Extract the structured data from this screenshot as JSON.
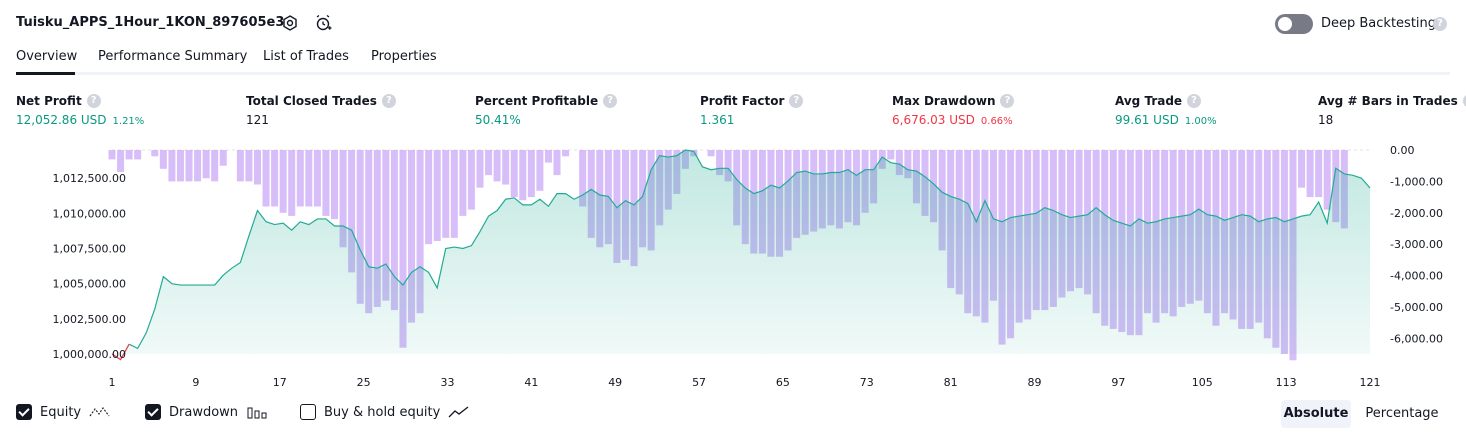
{
  "header": {
    "strategy_name": "Tuisku_APPS_1Hour_1KON_897605e3",
    "settings_icon": "settings-icon",
    "add_alert_icon": "alarm-plus-icon",
    "deep_backtesting_label": "Deep Backtesting",
    "deep_backtesting_enabled": false,
    "help_glyph": "?"
  },
  "tabs": [
    {
      "label": "Overview",
      "active": true
    },
    {
      "label": "Performance Summary",
      "active": false
    },
    {
      "label": "List of Trades",
      "active": false
    },
    {
      "label": "Properties",
      "active": false
    }
  ],
  "metrics": [
    {
      "label": "Net Profit",
      "value": "12,052.86 USD",
      "pct": "1.21%",
      "color": "#089981"
    },
    {
      "label": "Total Closed Trades",
      "value": "121",
      "pct": "",
      "color": "#131722"
    },
    {
      "label": "Percent Profitable",
      "value": "50.41%",
      "pct": "",
      "color": "#089981"
    },
    {
      "label": "Profit Factor",
      "value": "1.361",
      "pct": "",
      "color": "#089981"
    },
    {
      "label": "Max Drawdown",
      "value": "6,676.03 USD",
      "pct": "0.66%",
      "color": "#f23645"
    },
    {
      "label": "Avg Trade",
      "value": "99.61 USD",
      "pct": "1.00%",
      "color": "#089981"
    },
    {
      "label": "Avg # Bars in Trades",
      "value": "18",
      "pct": "",
      "color": "#131722"
    }
  ],
  "chart_data": {
    "type": "area",
    "x_tick_labels": [
      "1",
      "9",
      "17",
      "25",
      "33",
      "41",
      "49",
      "57",
      "65",
      "73",
      "81",
      "89",
      "97",
      "105",
      "113",
      "121"
    ],
    "left_axis_ticks": [
      "1,000,000.00",
      "1,002,500.00",
      "1,005,000.00",
      "1,007,500.00",
      "1,010,000.00",
      "1,012,500.00"
    ],
    "right_axis_ticks": [
      "0.00",
      "-1,000.00",
      "-2,000.00",
      "-3,000.00",
      "-4,000.00",
      "-5,000.00",
      "-6,000.00"
    ],
    "left_ylim": [
      1000000,
      1014500
    ],
    "right_ylim": [
      -6500,
      0
    ],
    "series": [
      {
        "name": "Equity",
        "color": "#22ab94",
        "values": [
          1000000,
          999600,
          1000700,
          1000400,
          1001500,
          1003200,
          1005500,
          1005000,
          1004900,
          1004900,
          1004900,
          1004900,
          1004900,
          1005600,
          1006100,
          1006500,
          1008400,
          1010200,
          1009400,
          1009200,
          1009300,
          1008800,
          1009400,
          1009200,
          1009600,
          1009600,
          1009100,
          1009100,
          1008800,
          1007400,
          1006200,
          1006100,
          1006400,
          1005500,
          1004900,
          1005800,
          1006200,
          1005800,
          1004700,
          1007500,
          1007600,
          1007500,
          1007700,
          1008700,
          1009800,
          1010200,
          1011000,
          1011100,
          1010600,
          1010600,
          1011000,
          1010500,
          1011400,
          1011400,
          1011000,
          1011300,
          1011700,
          1011300,
          1011200,
          1010400,
          1010900,
          1010600,
          1011200,
          1013100,
          1014100,
          1014000,
          1014100,
          1014500,
          1014400,
          1013300,
          1013100,
          1013200,
          1013200,
          1012400,
          1011800,
          1011400,
          1011600,
          1012000,
          1011800,
          1012300,
          1012900,
          1013000,
          1012800,
          1012800,
          1012900,
          1012900,
          1013100,
          1012700,
          1013100,
          1013100,
          1014000,
          1013600,
          1013500,
          1013100,
          1013000,
          1012600,
          1012100,
          1011500,
          1011200,
          1011000,
          1010700,
          1009400,
          1010900,
          1009600,
          1009400,
          1009700,
          1009800,
          1009900,
          1010000,
          1010400,
          1010200,
          1009900,
          1009700,
          1009800,
          1009900,
          1010400,
          1009900,
          1009500,
          1009300,
          1009100,
          1009600,
          1009300,
          1009400,
          1009600,
          1009700,
          1009800,
          1009900,
          1010300,
          1009900,
          1009800,
          1009500,
          1009700,
          1009900,
          1009800,
          1009400,
          1009600,
          1009700,
          1009400,
          1009600,
          1009800,
          1009900,
          1010800,
          1009300,
          1013200,
          1012800,
          1012700,
          1012500,
          1011800
        ]
      },
      {
        "name": "Drawdown",
        "color": "#c9a8f7",
        "values": [
          -300,
          -700,
          -300,
          -300,
          0,
          -200,
          -600,
          -1000,
          -1000,
          -1000,
          -1000,
          -900,
          -1000,
          -500,
          0,
          -1000,
          -1000,
          -1100,
          -1800,
          -1800,
          -2000,
          -2100,
          -1800,
          -1800,
          -1800,
          -2100,
          -2200,
          -3100,
          -3900,
          -4900,
          -5200,
          -5000,
          -4800,
          -5100,
          -6300,
          -5500,
          -5200,
          -3000,
          -2900,
          -2800,
          -2800,
          -2100,
          -1900,
          -1200,
          -800,
          -1000,
          -1100,
          -1500,
          -1600,
          -1500,
          -1300,
          -400,
          -800,
          -200,
          0,
          -1800,
          -2800,
          -3100,
          -3000,
          -3600,
          -3500,
          -3700,
          -3100,
          -3200,
          -2400,
          -1900,
          -1400,
          -600,
          -200,
          0,
          -200,
          -800,
          -1000,
          -2400,
          -3000,
          -3300,
          -3300,
          -3400,
          -3400,
          -3200,
          -2800,
          -2700,
          -2600,
          -2500,
          -2400,
          -2500,
          -2300,
          -2400,
          -2000,
          -1700,
          -600,
          -300,
          -800,
          -900,
          -1700,
          -2100,
          -2300,
          -3200,
          -4400,
          -4600,
          -5200,
          -5300,
          -5500,
          -4800,
          -6200,
          -6000,
          -5500,
          -5400,
          -5100,
          -5100,
          -5000,
          -4700,
          -4500,
          -4400,
          -4600,
          -5200,
          -5600,
          -5700,
          -5800,
          -5900,
          -5900,
          -5200,
          -5500,
          -5200,
          -5300,
          -5000,
          -4900,
          -4800,
          -5200,
          -5600,
          -5200,
          -5400,
          -5700,
          -5700,
          -5500,
          -6000,
          -6300,
          -6500,
          -6700,
          -1200,
          -1500,
          -1500,
          -1900,
          -2300,
          -2500
        ]
      }
    ],
    "legend": [
      {
        "label": "Equity",
        "checked": true,
        "icon": "equity-line-icon"
      },
      {
        "label": "Drawdown",
        "checked": true,
        "icon": "drawdown-bars-icon"
      },
      {
        "label": "Buy & hold equity",
        "checked": false,
        "icon": "buy-hold-line-icon"
      }
    ],
    "scale_buttons": {
      "absolute": "Absolute",
      "percentage": "Percentage",
      "active": "absolute"
    }
  }
}
